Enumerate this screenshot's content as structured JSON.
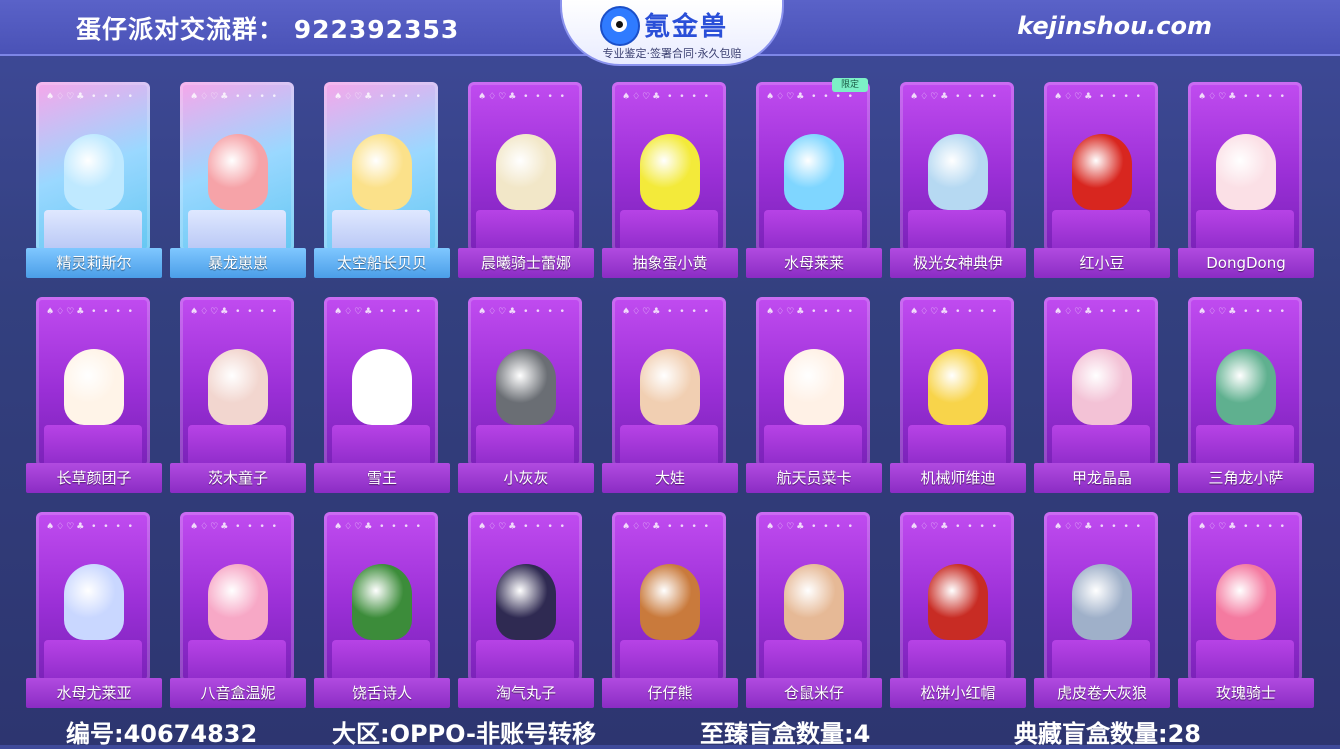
{
  "header": {
    "group_text": "蛋仔派对交流群：  922392353",
    "site": "kejinshou.com",
    "logo_title": "氪金兽",
    "logo_slogan": "专业鉴定·签署合同·永久包赔"
  },
  "cards": [
    {
      "name": "精灵莉斯尔",
      "style": "special",
      "color": "#bfe9ff"
    },
    {
      "name": "暴龙崽崽",
      "style": "special",
      "color": "#f6a3a8"
    },
    {
      "name": "太空船长贝贝",
      "style": "special",
      "color": "#fbe18a"
    },
    {
      "name": "晨曦骑士蕾娜",
      "style": "normal",
      "color": "#f2e7c8"
    },
    {
      "name": "抽象蛋小黄",
      "style": "normal",
      "color": "#f3ea3a"
    },
    {
      "name": "水母莱莱",
      "style": "normal",
      "color": "#7fd6ff",
      "badge": "限定"
    },
    {
      "name": "极光女神典伊",
      "style": "normal",
      "color": "#b6d9f2"
    },
    {
      "name": "红小豆",
      "style": "normal",
      "color": "#d8261f"
    },
    {
      "name": "DongDong",
      "style": "normal",
      "color": "#fbe0e6"
    },
    {
      "name": "长草颜团子",
      "style": "normal",
      "color": "#fff4e8"
    },
    {
      "name": "茨木童子",
      "style": "normal",
      "color": "#f2d6cf"
    },
    {
      "name": "雪王",
      "style": "normal",
      "color": "#ffffff"
    },
    {
      "name": "小灰灰",
      "style": "normal",
      "color": "#6a6e74"
    },
    {
      "name": "大娃",
      "style": "normal",
      "color": "#f1cfb2"
    },
    {
      "name": "航天员菜卡",
      "style": "normal",
      "color": "#fff1e6"
    },
    {
      "name": "机械师维迪",
      "style": "normal",
      "color": "#f8d44a"
    },
    {
      "name": "甲龙晶晶",
      "style": "normal",
      "color": "#f3c2d6"
    },
    {
      "name": "三角龙小萨",
      "style": "normal",
      "color": "#5fb08f"
    },
    {
      "name": "水母尤莱亚",
      "style": "normal",
      "color": "#c9d7ff"
    },
    {
      "name": "八音盒温妮",
      "style": "normal",
      "color": "#f7a8c6"
    },
    {
      "name": "饶舌诗人",
      "style": "normal",
      "color": "#3c8c3a"
    },
    {
      "name": "淘气丸子",
      "style": "normal",
      "color": "#2f2a52"
    },
    {
      "name": "仔仔熊",
      "style": "normal",
      "color": "#c97a3c"
    },
    {
      "name": "仓鼠米仔",
      "style": "normal",
      "color": "#e6b996"
    },
    {
      "name": "松饼小红帽",
      "style": "normal",
      "color": "#c82c24"
    },
    {
      "name": "虎皮卷大灰狼",
      "style": "normal",
      "color": "#9fb0c9"
    },
    {
      "name": "玫瑰骑士",
      "style": "normal",
      "color": "#f47aa0"
    }
  ],
  "footer": {
    "id_text": "编号:40674832",
    "region_text": "大区:OPPO-非账号转移",
    "supreme_text": "至臻盲盒数量:4",
    "collection_text": "典藏盲盒数量:28"
  },
  "suits_text": "♠♢♡♣ • • • •",
  "colors": {
    "background": "#35407f",
    "card_purple": "#a438dc",
    "special_blue": "#6cc4f4"
  }
}
